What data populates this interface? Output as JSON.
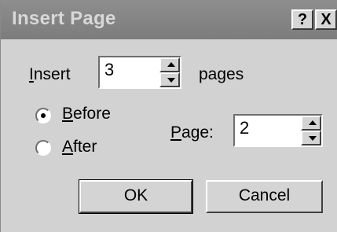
{
  "dialog": {
    "title": "Insert Page",
    "help_label": "?",
    "close_label": "X"
  },
  "insert": {
    "label_prefix": "",
    "label_mnemonic": "I",
    "label_rest": "nsert",
    "value": "3",
    "suffix": "pages"
  },
  "position": {
    "before": {
      "mnemonic": "B",
      "rest": "efore",
      "selected": true
    },
    "after": {
      "mnemonic": "A",
      "rest": "fter",
      "selected": false
    }
  },
  "page": {
    "label_mnemonic": "P",
    "label_rest": "age:",
    "value": "2"
  },
  "buttons": {
    "ok": "OK",
    "cancel": "Cancel"
  }
}
